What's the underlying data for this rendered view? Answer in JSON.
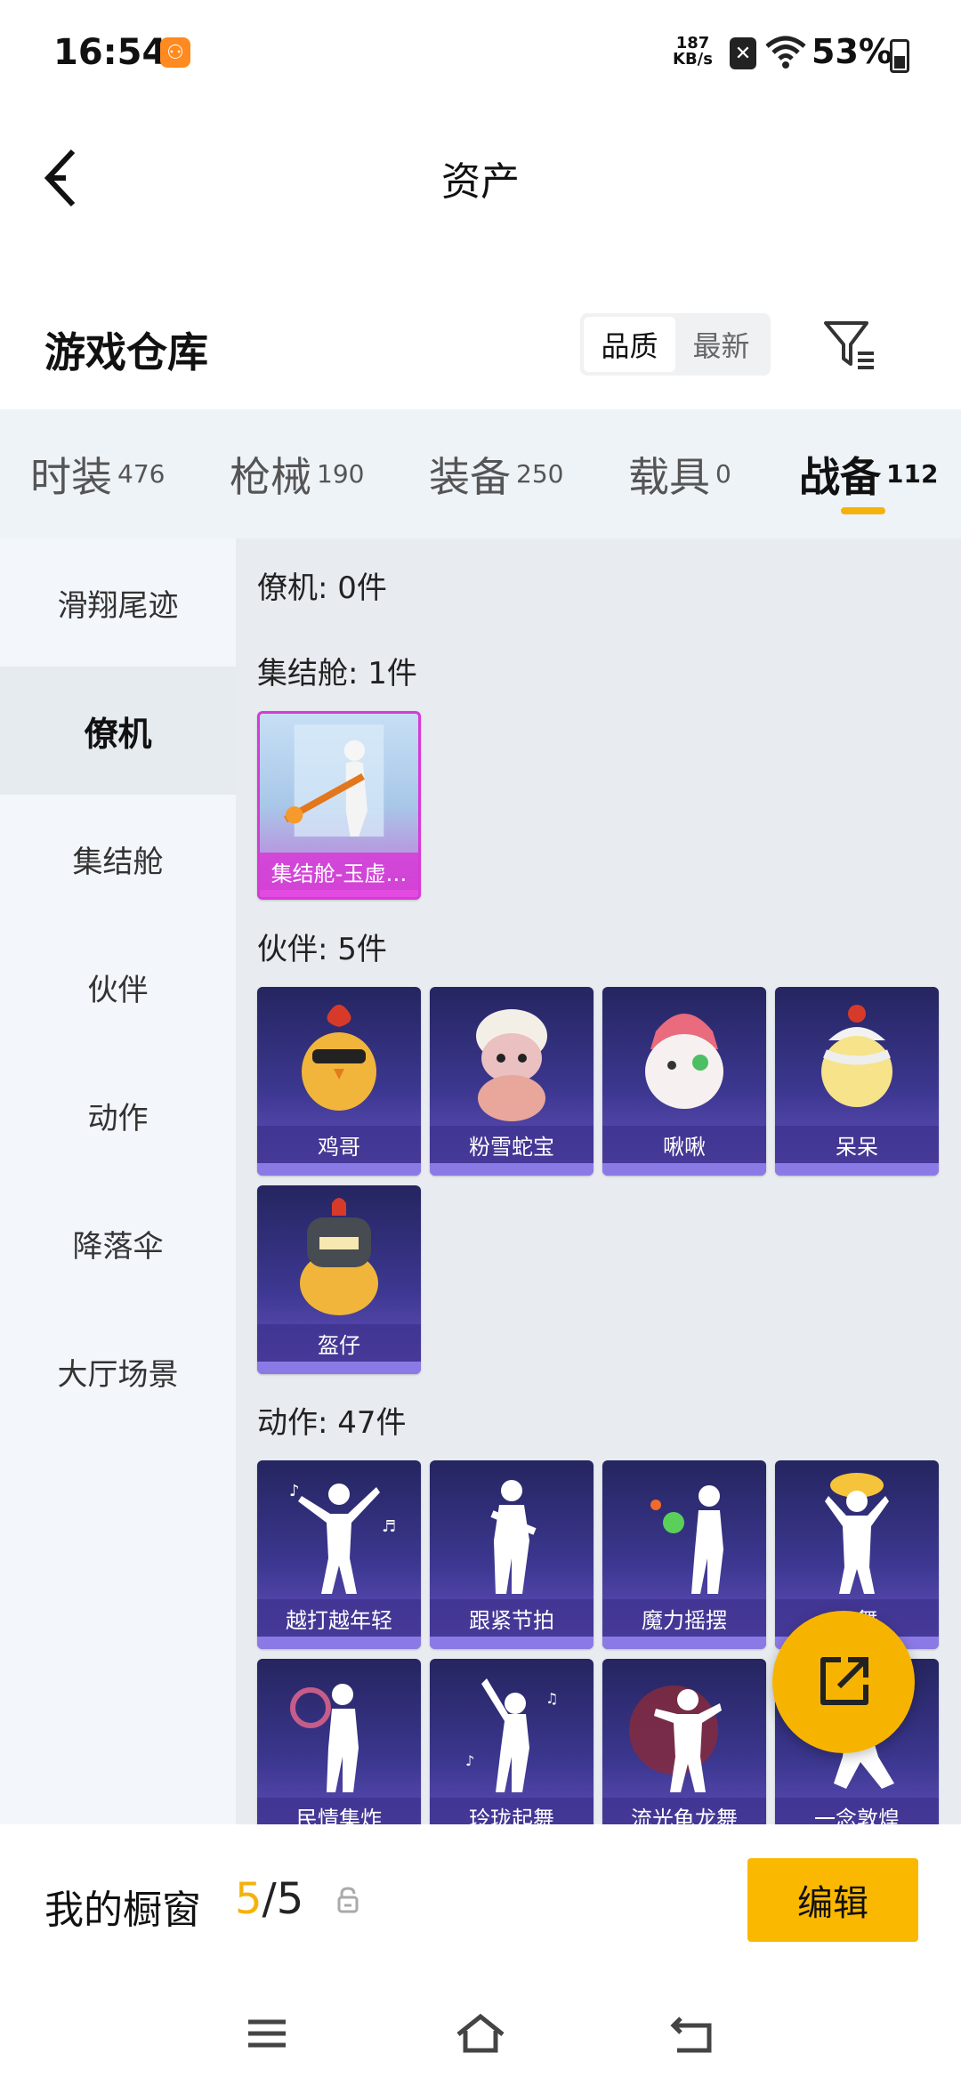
{
  "status_bar": {
    "time": "16:54",
    "app_badge": "⚇",
    "net_speed_value": "187",
    "net_speed_unit": "KB/s",
    "battery_percent": "53%"
  },
  "header": {
    "title": "资产"
  },
  "warehouse": {
    "title": "游戏仓库",
    "sort_options": [
      "品质",
      "最新"
    ],
    "active_sort": "品质"
  },
  "tabs": [
    {
      "label": "时装",
      "count": "476"
    },
    {
      "label": "枪械",
      "count": "190"
    },
    {
      "label": "装备",
      "count": "250"
    },
    {
      "label": "载具",
      "count": "0"
    },
    {
      "label": "战备",
      "count": "112"
    }
  ],
  "active_tab": "战备",
  "sidebar": {
    "items": [
      "滑翔尾迹",
      "僚机",
      "集结舱",
      "伙伴",
      "动作",
      "降落伞",
      "大厅场景"
    ],
    "active": "僚机"
  },
  "sections": [
    {
      "title": "僚机: 0件",
      "items": []
    },
    {
      "title": "集结舱: 1件",
      "items": [
        "集结舱-玉虚…"
      ]
    },
    {
      "title": "伙伴: 5件",
      "items": [
        "鸡哥",
        "粉雪蛇宝",
        "啾啾",
        "呆呆",
        "盔仔"
      ]
    },
    {
      "title": "动作: 47件",
      "items": [
        "越打越年轻",
        "跟紧节拍",
        "魔力摇摆",
        "…舞",
        "民情集炸",
        "玲珑起舞",
        "流光龟龙舞",
        "一念敦煌"
      ]
    }
  ],
  "showcase": {
    "label": "我的橱窗",
    "current": "5",
    "separator": "/",
    "total": "5",
    "edit_label": "编辑"
  },
  "colors": {
    "accent": "#f5b20b",
    "card_purple": "#3c3790",
    "card_special": "#d53bd6"
  }
}
